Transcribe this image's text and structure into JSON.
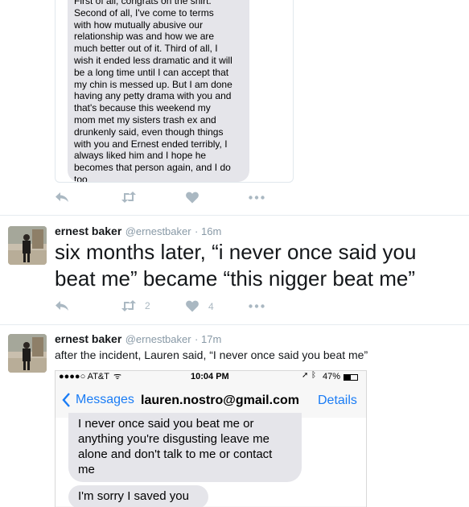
{
  "colors": {
    "link_blue": "#1a7cf5",
    "icon_gray": "#aab8c2",
    "bubble_gray": "#e5e5ea",
    "text": "#14171a",
    "muted": "#8899a6"
  },
  "top_card": {
    "message_lines": [
      "First of all, congrats on the shirt.",
      "Second of all, I've come to terms",
      "with how mutually abusive our",
      "relationship was and how we are",
      "much better out of it. Third of all, I",
      "wish it ended less dramatic and it will",
      "be a long time until I can accept that",
      "my chin is messed up. But I am done",
      "having any petty drama with you and",
      "that's because this weekend my",
      "mom met my sisters trash ex and",
      "drunkenly said, even though things",
      "with you and Ernest ended terribly, I",
      "always liked him and I hope he",
      "becomes that person again, and I do",
      "too"
    ],
    "actions": {
      "reply_icon": "reply-icon",
      "retweet_icon": "retweet-icon",
      "like_icon": "heart-icon",
      "more_icon": "more-icon"
    }
  },
  "tweet1": {
    "name": "ernest baker",
    "handle": "@ernestbaker",
    "time": "· 16m",
    "text": "six months later, “i never once said you beat me” became “this nigger beat me”",
    "retweets": "2",
    "likes": "4"
  },
  "tweet2": {
    "name": "ernest baker",
    "handle": "@ernestbaker",
    "time": "· 17m",
    "text": "after the incident, Lauren said, “I never once said you beat me”",
    "phone": {
      "carrier": "●●●●○ AT&T",
      "time": "10:04 PM",
      "battery": "47%",
      "back_label": "Messages",
      "contact": "lauren.nostro@gmail.com",
      "details_label": "Details",
      "message1": "I never once said you beat me or anything you're disgusting leave me alone and don't talk to me or contact me",
      "message2": "I'm sorry I saved you"
    }
  }
}
